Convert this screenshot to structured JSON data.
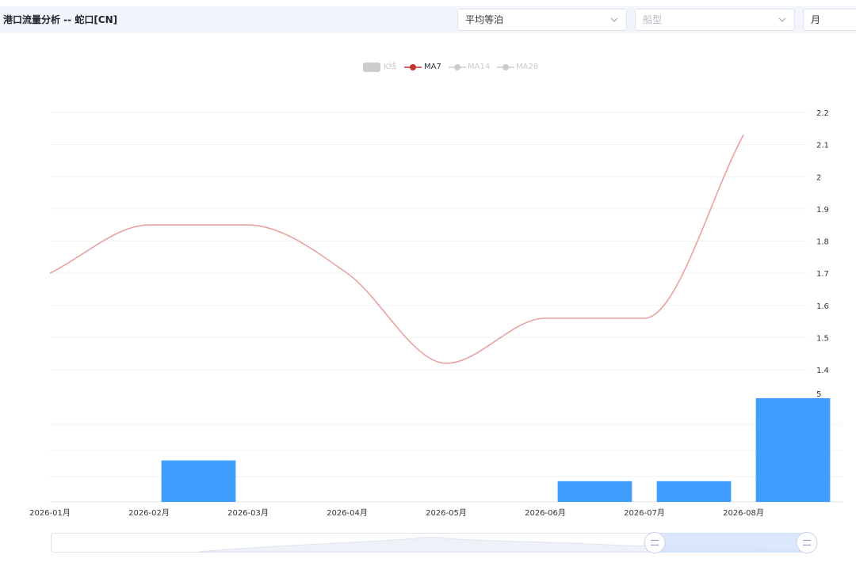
{
  "header": {
    "title": "港口流量分析 -- 蛇口[CN]",
    "metric_select": {
      "value": "平均等泊"
    },
    "ship_type_select": {
      "placeholder": "船型"
    },
    "period_select": {
      "value": "月"
    }
  },
  "legend": [
    {
      "label": "K线",
      "active": false,
      "color": "#cccccc"
    },
    {
      "label": "MA7",
      "active": true,
      "color": "#c23531"
    },
    {
      "label": "MA14",
      "active": false,
      "color": "#cccccc"
    },
    {
      "label": "MA28",
      "active": false,
      "color": "#cccccc"
    }
  ],
  "chart_data": {
    "type": "line",
    "categories": [
      "2026-01月",
      "2026-02月",
      "2026-03月",
      "2026-04月",
      "2026-05月",
      "2026-06月",
      "2026-07月",
      "2026-08月"
    ],
    "series": [
      {
        "name": "MA7",
        "color": "#e8a3a0",
        "values": [
          1.7,
          1.85,
          1.85,
          1.7,
          1.42,
          1.56,
          1.56,
          2.13
        ]
      }
    ],
    "y_ticks": [
      "2.2",
      "2.1",
      "2",
      "1.9",
      "1.8",
      "1.7",
      "1.6",
      "1.5",
      "1.4"
    ],
    "ylim": [
      1.4,
      2.2
    ],
    "volume": {
      "type": "bar",
      "color": "#409eff",
      "values": [
        0,
        2,
        0,
        0,
        0,
        1,
        1,
        5
      ],
      "max_label": "5",
      "ylim": [
        0,
        5
      ]
    },
    "grid": true
  },
  "data_zoom": {
    "start_percent": 80,
    "end_percent": 100
  }
}
